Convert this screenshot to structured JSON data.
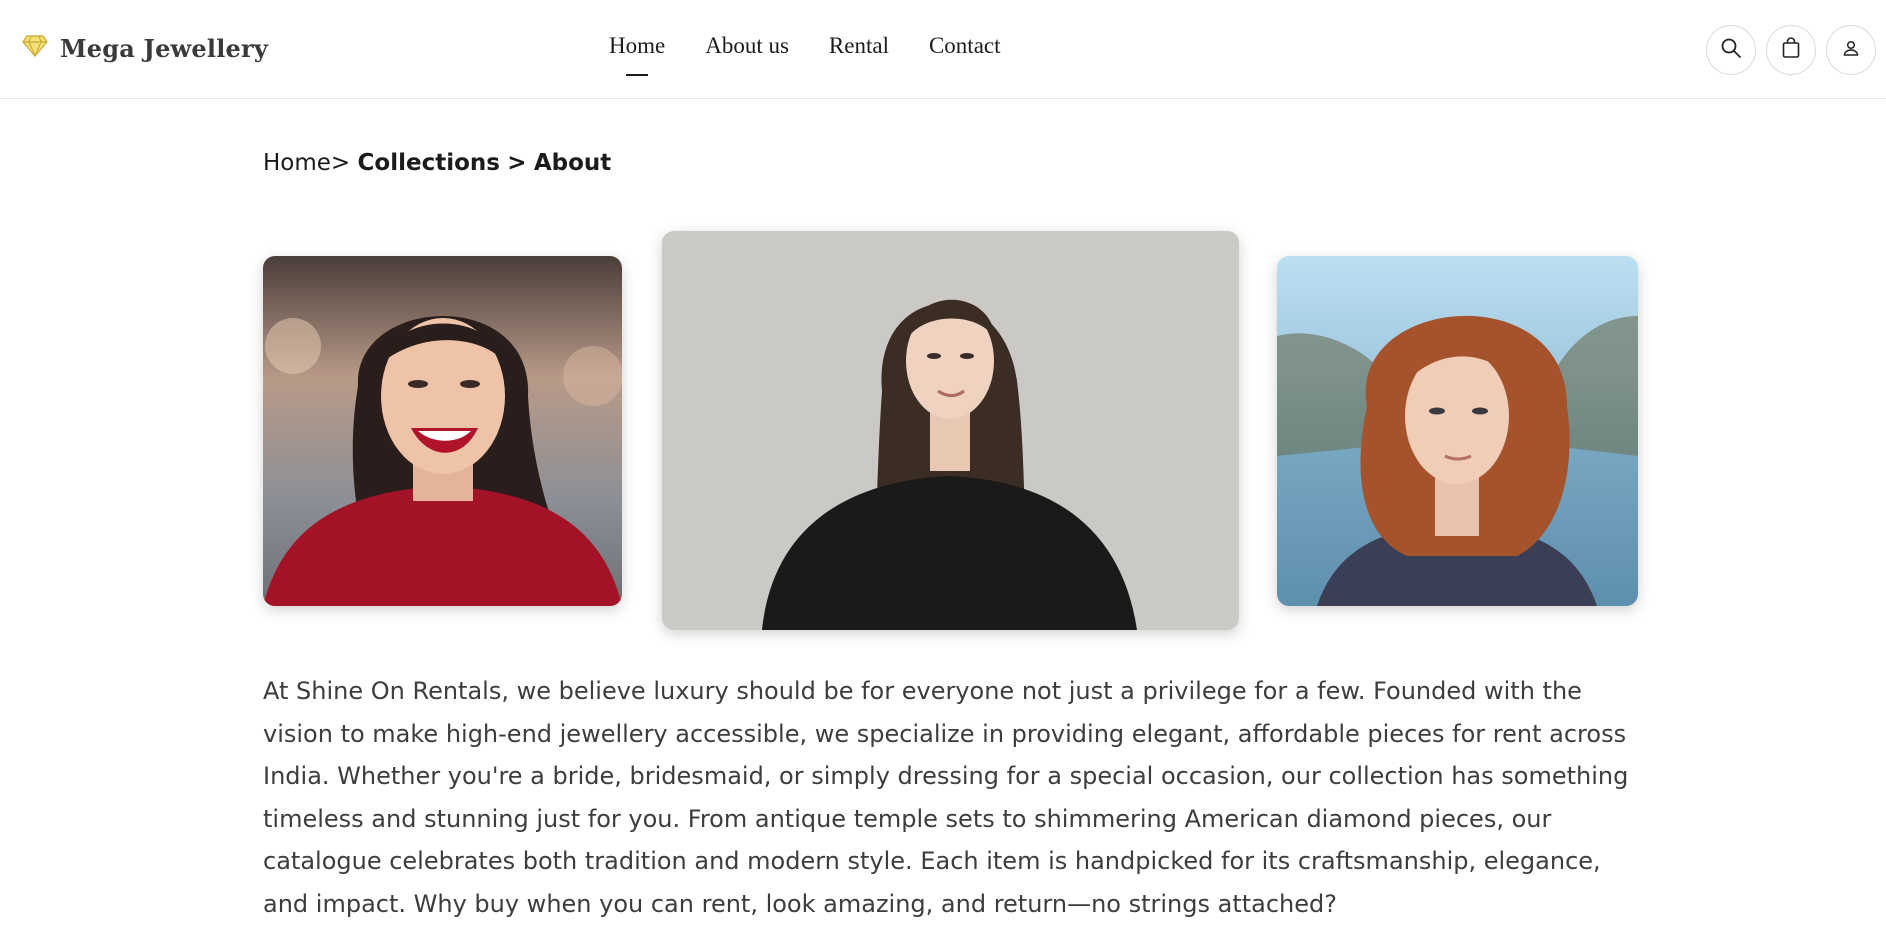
{
  "brand": {
    "name": "Mega Jewellery",
    "icon": "diamond-icon",
    "icon_color": "#e8c84a"
  },
  "nav": {
    "items": [
      {
        "label": "Home",
        "active": true
      },
      {
        "label": "About us",
        "active": false
      },
      {
        "label": "Rental",
        "active": false
      },
      {
        "label": "Contact",
        "active": false
      }
    ]
  },
  "header_actions": [
    {
      "icon": "search-icon"
    },
    {
      "icon": "shopping-bag-icon"
    },
    {
      "icon": "user-icon"
    }
  ],
  "breadcrumb": {
    "home": "Home>",
    "collections": "Collections",
    "separator": ">",
    "current": "About"
  },
  "gallery": [
    {
      "subject": "smiling woman in red top"
    },
    {
      "subject": "woman in black t-shirt"
    },
    {
      "subject": "woman with auburn bob hair"
    }
  ],
  "about": {
    "text": "At Shine On Rentals, we believe luxury should be for everyone not just a privilege for a few. Founded with the vision to make high-end jewellery accessible, we specialize in providing elegant, affordable pieces for rent across India. Whether you're a bride, bridesmaid, or simply dressing for a special occasion, our collection has something timeless and stunning just for you. From antique temple sets to shimmering American diamond pieces, our catalogue celebrates both tradition and modern style. Each item is handpicked for its craftsmanship, elegance, and impact. Why buy when you can rent, look amazing, and return—no strings attached?"
  },
  "colors": {
    "text": "#3d3d3d",
    "heading": "#1b1b1b",
    "border": "#e6e6e6"
  }
}
